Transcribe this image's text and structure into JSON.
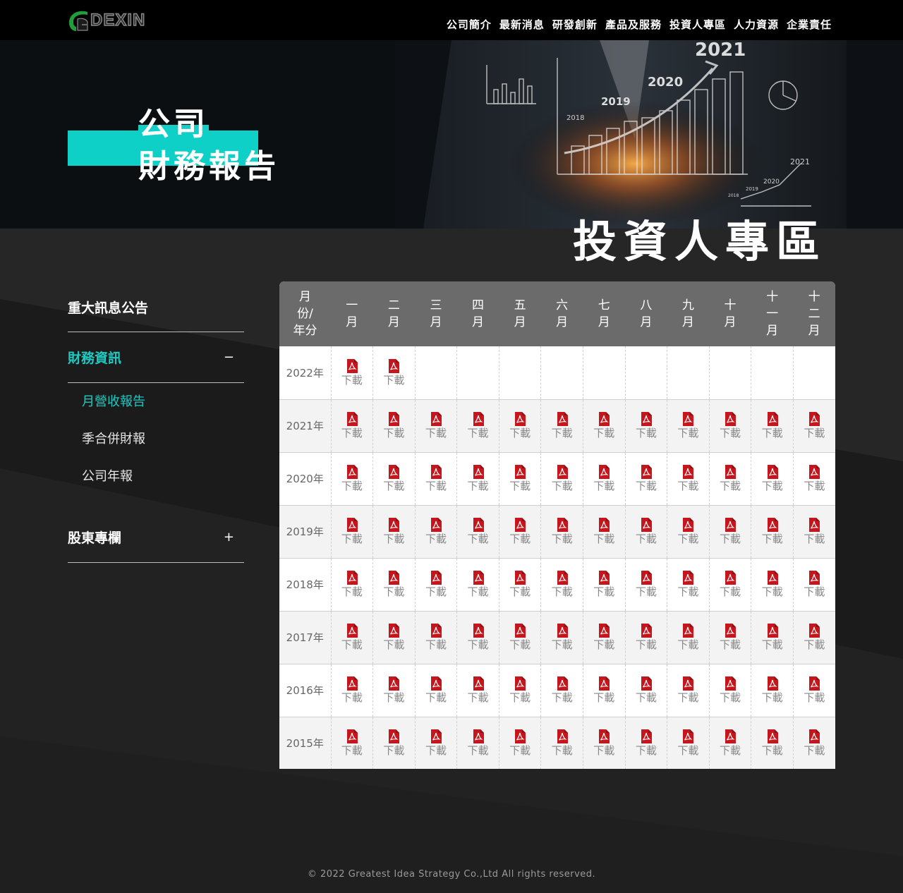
{
  "brand": {
    "logo_text": "DEXIN",
    "colors": {
      "accent": "#1ec9c1",
      "pdf": "#c4161c",
      "header_bg": "#000000"
    }
  },
  "nav": {
    "items": [
      "公司簡介",
      "最新消息",
      "研發創新",
      "產品及服務",
      "投資人專區",
      "人力資源",
      "企業責任"
    ]
  },
  "hero": {
    "title_line1": "公司",
    "title_line2": "財務報告",
    "art_labels": [
      "2021",
      "2020",
      "2019",
      "2018",
      "2021",
      "2020",
      "2019",
      "2018"
    ]
  },
  "section_title": "投資人專區",
  "sidebar": {
    "items": [
      {
        "label": "重大訊息公告",
        "toggle": "",
        "active": false
      },
      {
        "label": "財務資訊",
        "toggle": "−",
        "active": true
      },
      {
        "label": "股東專欄",
        "toggle": "+",
        "active": false
      }
    ],
    "sub_items": [
      {
        "label": "月營收報告",
        "active": true
      },
      {
        "label": "季合併財報",
        "active": false
      },
      {
        "label": "公司年報",
        "active": false
      }
    ]
  },
  "table": {
    "corner_header": "月份/年分",
    "months": [
      "一月",
      "二月",
      "三月",
      "四月",
      "五月",
      "六月",
      "七月",
      "八月",
      "九月",
      "十月",
      "十一月",
      "十二月"
    ],
    "download_label": "下載",
    "download_icon": "pdf-icon",
    "rows": [
      {
        "year": "2022年",
        "available": 2
      },
      {
        "year": "2021年",
        "available": 12
      },
      {
        "year": "2020年",
        "available": 12
      },
      {
        "year": "2019年",
        "available": 12
      },
      {
        "year": "2018年",
        "available": 12
      },
      {
        "year": "2017年",
        "available": 12
      },
      {
        "year": "2016年",
        "available": 12
      },
      {
        "year": "2015年",
        "available": 12
      }
    ]
  },
  "footer": {
    "copyright": "© 2022 Greatest Idea Strategy Co.,Ltd All rights reserved."
  }
}
